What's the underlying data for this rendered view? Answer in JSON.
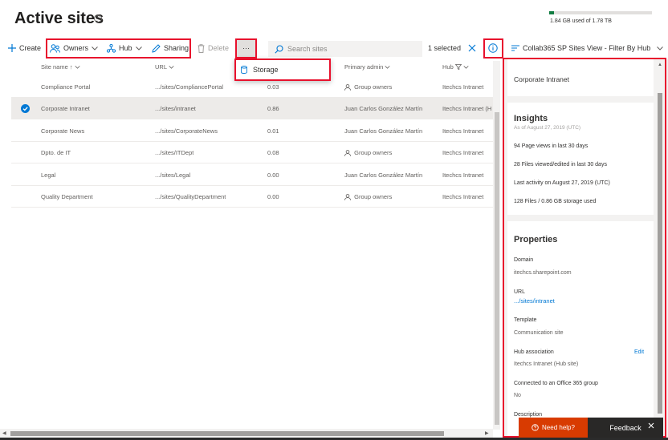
{
  "header": {
    "title": "Active sites",
    "storage_text": "1.84 GB used of 1.78 TB",
    "storage_fraction": 0.05
  },
  "toolbar": {
    "create": "Create",
    "owners": "Owners",
    "hub": "Hub",
    "sharing": "Sharing",
    "delete": "Delete",
    "more": "···",
    "search_placeholder": "Search sites",
    "selected": "1 selected",
    "view": "Collab365 SP Sites View - Filter By Hub"
  },
  "more_menu": {
    "storage": "Storage"
  },
  "grid": {
    "columns": {
      "name": "Site name ↑",
      "url": "URL",
      "admin": "Primary admin",
      "hub": "Hub"
    },
    "rows": [
      {
        "name": "Compliance Portal",
        "url": ".../sites/CompliancePortal",
        "storage": "0.03",
        "admin": "Group owners",
        "admin_is_group": true,
        "hub": "Itechcs Intranet",
        "selected": false
      },
      {
        "name": "Corporate Intranet",
        "url": ".../sites/intranet",
        "storage": "0.86",
        "admin": "Juan Carlos González Martín",
        "admin_is_group": false,
        "hub": "Itechcs Intranet (H",
        "selected": true
      },
      {
        "name": "Corporate News",
        "url": ".../sites/CorporateNews",
        "storage": "0.01",
        "admin": "Juan Carlos González Martín",
        "admin_is_group": false,
        "hub": "Itechcs Intranet",
        "selected": false
      },
      {
        "name": "Dpto. de IT",
        "url": ".../sites/ITDept",
        "storage": "0.08",
        "admin": "Group owners",
        "admin_is_group": true,
        "hub": "Itechcs Intranet",
        "selected": false
      },
      {
        "name": "Legal",
        "url": ".../sites/Legal",
        "storage": "0.00",
        "admin": "Juan Carlos González Martín",
        "admin_is_group": false,
        "hub": "Itechcs Intranet",
        "selected": false
      },
      {
        "name": "Quality Department",
        "url": ".../sites/QualityDepartment",
        "storage": "0.00",
        "admin": "Group owners",
        "admin_is_group": true,
        "hub": "Itechcs Intranet",
        "selected": false
      }
    ]
  },
  "panel": {
    "site_title": "Corporate Intranet",
    "insights": {
      "title": "Insights",
      "as_of": "As of August 27, 2019 (UTC)",
      "page_views": "94 Page views in last 30 days",
      "files_viewed": "28 Files viewed/edited in last 30 days",
      "last_activity": "Last activity on August 27, 2019 (UTC)",
      "files_storage": "128 Files / 0.86 GB storage used"
    },
    "properties": {
      "title": "Properties",
      "domain_label": "Domain",
      "domain_value": "itechcs.sharepoint.com",
      "url_label": "URL",
      "url_value": ".../sites/intranet",
      "template_label": "Template",
      "template_value": "Communication site",
      "hub_label": "Hub association",
      "hub_edit": "Edit",
      "hub_value": "Itechcs Intranet (Hub site)",
      "group_label": "Connected to an Office 365 group",
      "group_value": "No",
      "description_label": "Description"
    }
  },
  "footer": {
    "need_help": "Need help?",
    "feedback": "Feedback"
  },
  "colors": {
    "accent": "#0078d4",
    "highlight": "#e8112d",
    "need_help_bg": "#d83b01",
    "feedback_bg": "#292827"
  }
}
